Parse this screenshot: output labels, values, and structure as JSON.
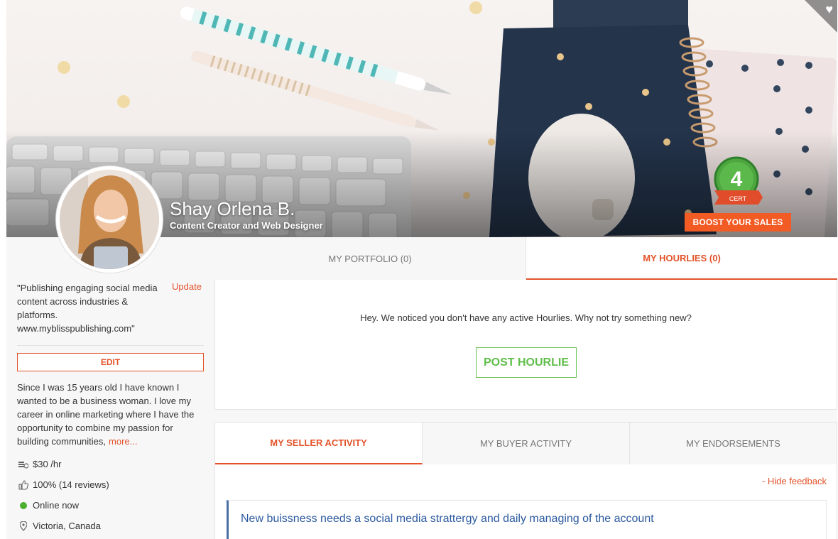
{
  "profile": {
    "name": "Shay Orlena B.",
    "title": "Content Creator and Web Designer",
    "cert_level": "4",
    "cert_label": "CERT",
    "boost_label": "BOOST YOUR SALES",
    "quote": "\"Publishing engaging social media content across industries & platforms. www.myblisspublishing.com\"",
    "update_label": "Update",
    "edit_label": "EDIT",
    "bio": "Since I was 15 years old I have known I wanted to be a business woman. I love my career in online marketing where I have the opportunity to combine my passion for building communities,",
    "more_label": "more...",
    "rate": "$30 /hr",
    "rating": "100% (14 reviews)",
    "status": "Online now",
    "location": "Victoria, Canada"
  },
  "tabs_top": [
    {
      "label": "MY PORTFOLIO (0)",
      "active": false
    },
    {
      "label": "MY HOURLIES (0)",
      "active": true
    }
  ],
  "hourlies": {
    "empty_message": "Hey. We noticed you don't have any active Hourlies. Why not try something new?",
    "post_label": "POST HOURLIE"
  },
  "tabs_bottom": [
    {
      "label": "MY SELLER ACTIVITY",
      "active": true
    },
    {
      "label": "MY BUYER ACTIVITY",
      "active": false
    },
    {
      "label": "MY ENDORSEMENTS",
      "active": false
    }
  ],
  "activity": {
    "hide_feedback_label": "- Hide feedback",
    "feedback_items": [
      {
        "title": "New buissness needs a social media strattergy and daily managing of the account"
      }
    ]
  },
  "colors": {
    "accent": "#e2532a",
    "boost": "#f25b24",
    "post_green": "#5fbe4a",
    "online": "#4caf32",
    "feedback_title": "#2c5aa0"
  },
  "icons": {
    "favorite": "heart-icon",
    "rate": "money-stack-icon",
    "rating": "thumbs-up-icon",
    "status": "online-dot-icon",
    "location": "map-pin-icon"
  }
}
